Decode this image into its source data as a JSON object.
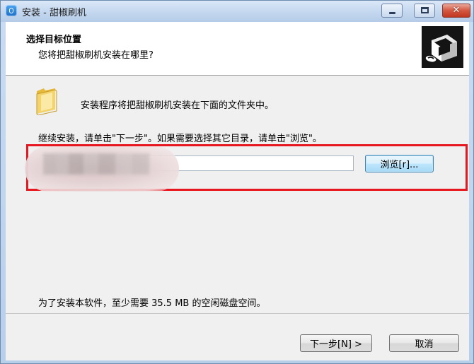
{
  "window": {
    "title": "安装 - 甜椒刷机"
  },
  "header": {
    "title": "选择目标位置",
    "subtitle": "您将把甜椒刷机安装在哪里?"
  },
  "main": {
    "intro_text": "安装程序将把甜椒刷机安装在下面的文件夹中。",
    "instruction_text": "继续安装，请单击\"下一步\"。如果需要选择其它目录，请单击\"浏览\"。",
    "path_value": "",
    "browse_label": "浏览[r]...",
    "disk_space_text": "为了安装本软件，至少需要 35.5 MB 的空闲磁盘空间。"
  },
  "footer": {
    "next_label": "下一步[N] >",
    "cancel_label": "取消"
  },
  "icons": {
    "app": "app-icon",
    "folder": "folder-icon",
    "logo": "installer-logo-icon",
    "minimize": "minimize-icon",
    "maximize": "maximize-icon",
    "close": "close-icon"
  },
  "colors": {
    "highlight_border": "#e8161e",
    "title_bar": "#c3d7ef",
    "close_button": "#d4573f",
    "dialog_background": "#f0f0f0"
  }
}
